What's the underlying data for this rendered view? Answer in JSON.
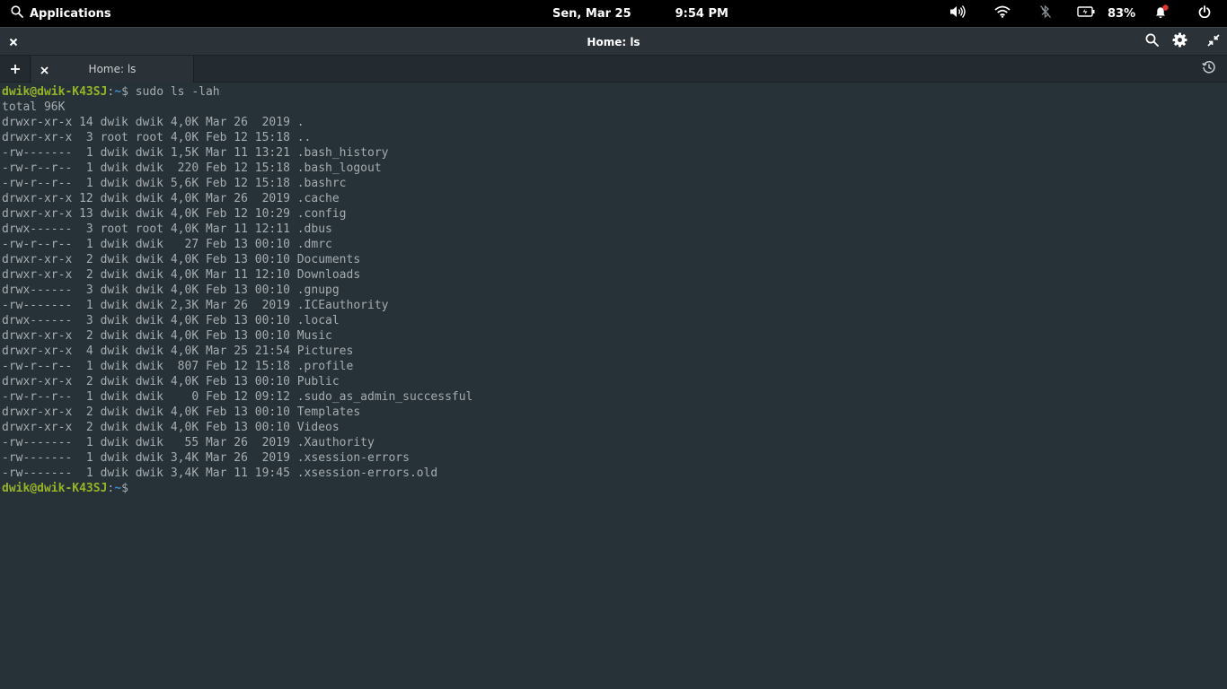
{
  "panel": {
    "applications_label": "Applications",
    "date": "Sen, Mar 25",
    "time": "9:54 PM",
    "battery_percent": "83%",
    "icons": [
      "search-icon",
      "volume-icon",
      "wifi-icon",
      "bluetooth-disabled-icon",
      "battery-icon",
      "notification-icon",
      "power-icon"
    ],
    "notification_dot_color": "#e0362b"
  },
  "window": {
    "title": "Home: ls"
  },
  "tabs": [
    {
      "label": "Home: ls"
    }
  ],
  "terminal": {
    "prompt_user": "dwik@dwik-K43SJ",
    "prompt_sep": ":",
    "prompt_path": "~",
    "prompt_symbol": "$ ",
    "command": "sudo ls -lah",
    "total": "total 96K",
    "listing": [
      "drwxr-xr-x 14 dwik dwik 4,0K Mar 26  2019 .",
      "drwxr-xr-x  3 root root 4,0K Feb 12 15:18 ..",
      "-rw-------  1 dwik dwik 1,5K Mar 11 13:21 .bash_history",
      "-rw-r--r--  1 dwik dwik  220 Feb 12 15:18 .bash_logout",
      "-rw-r--r--  1 dwik dwik 5,6K Feb 12 15:18 .bashrc",
      "drwxr-xr-x 12 dwik dwik 4,0K Mar 26  2019 .cache",
      "drwxr-xr-x 13 dwik dwik 4,0K Feb 12 10:29 .config",
      "drwx------  3 root root 4,0K Mar 11 12:11 .dbus",
      "-rw-r--r--  1 dwik dwik   27 Feb 13 00:10 .dmrc",
      "drwxr-xr-x  2 dwik dwik 4,0K Feb 13 00:10 Documents",
      "drwxr-xr-x  2 dwik dwik 4,0K Mar 11 12:10 Downloads",
      "drwx------  3 dwik dwik 4,0K Feb 13 00:10 .gnupg",
      "-rw-------  1 dwik dwik 2,3K Mar 26  2019 .ICEauthority",
      "drwx------  3 dwik dwik 4,0K Feb 13 00:10 .local",
      "drwxr-xr-x  2 dwik dwik 4,0K Feb 13 00:10 Music",
      "drwxr-xr-x  4 dwik dwik 4,0K Mar 25 21:54 Pictures",
      "-rw-r--r--  1 dwik dwik  807 Feb 12 15:18 .profile",
      "drwxr-xr-x  2 dwik dwik 4,0K Feb 13 00:10 Public",
      "-rw-r--r--  1 dwik dwik    0 Feb 12 09:12 .sudo_as_admin_successful",
      "drwxr-xr-x  2 dwik dwik 4,0K Feb 13 00:10 Templates",
      "drwxr-xr-x  2 dwik dwik 4,0K Feb 13 00:10 Videos",
      "-rw-------  1 dwik dwik   55 Mar 26  2019 .Xauthority",
      "-rw-------  1 dwik dwik 3,4K Mar 26  2019 .xsession-errors",
      "-rw-------  1 dwik dwik 3,4K Mar 11 19:45 .xsession-errors.old"
    ],
    "colors": {
      "background": "#263238",
      "foreground": "#a7acaf",
      "prompt_user": "#97b427",
      "prompt_path": "#3a8fc7"
    }
  }
}
